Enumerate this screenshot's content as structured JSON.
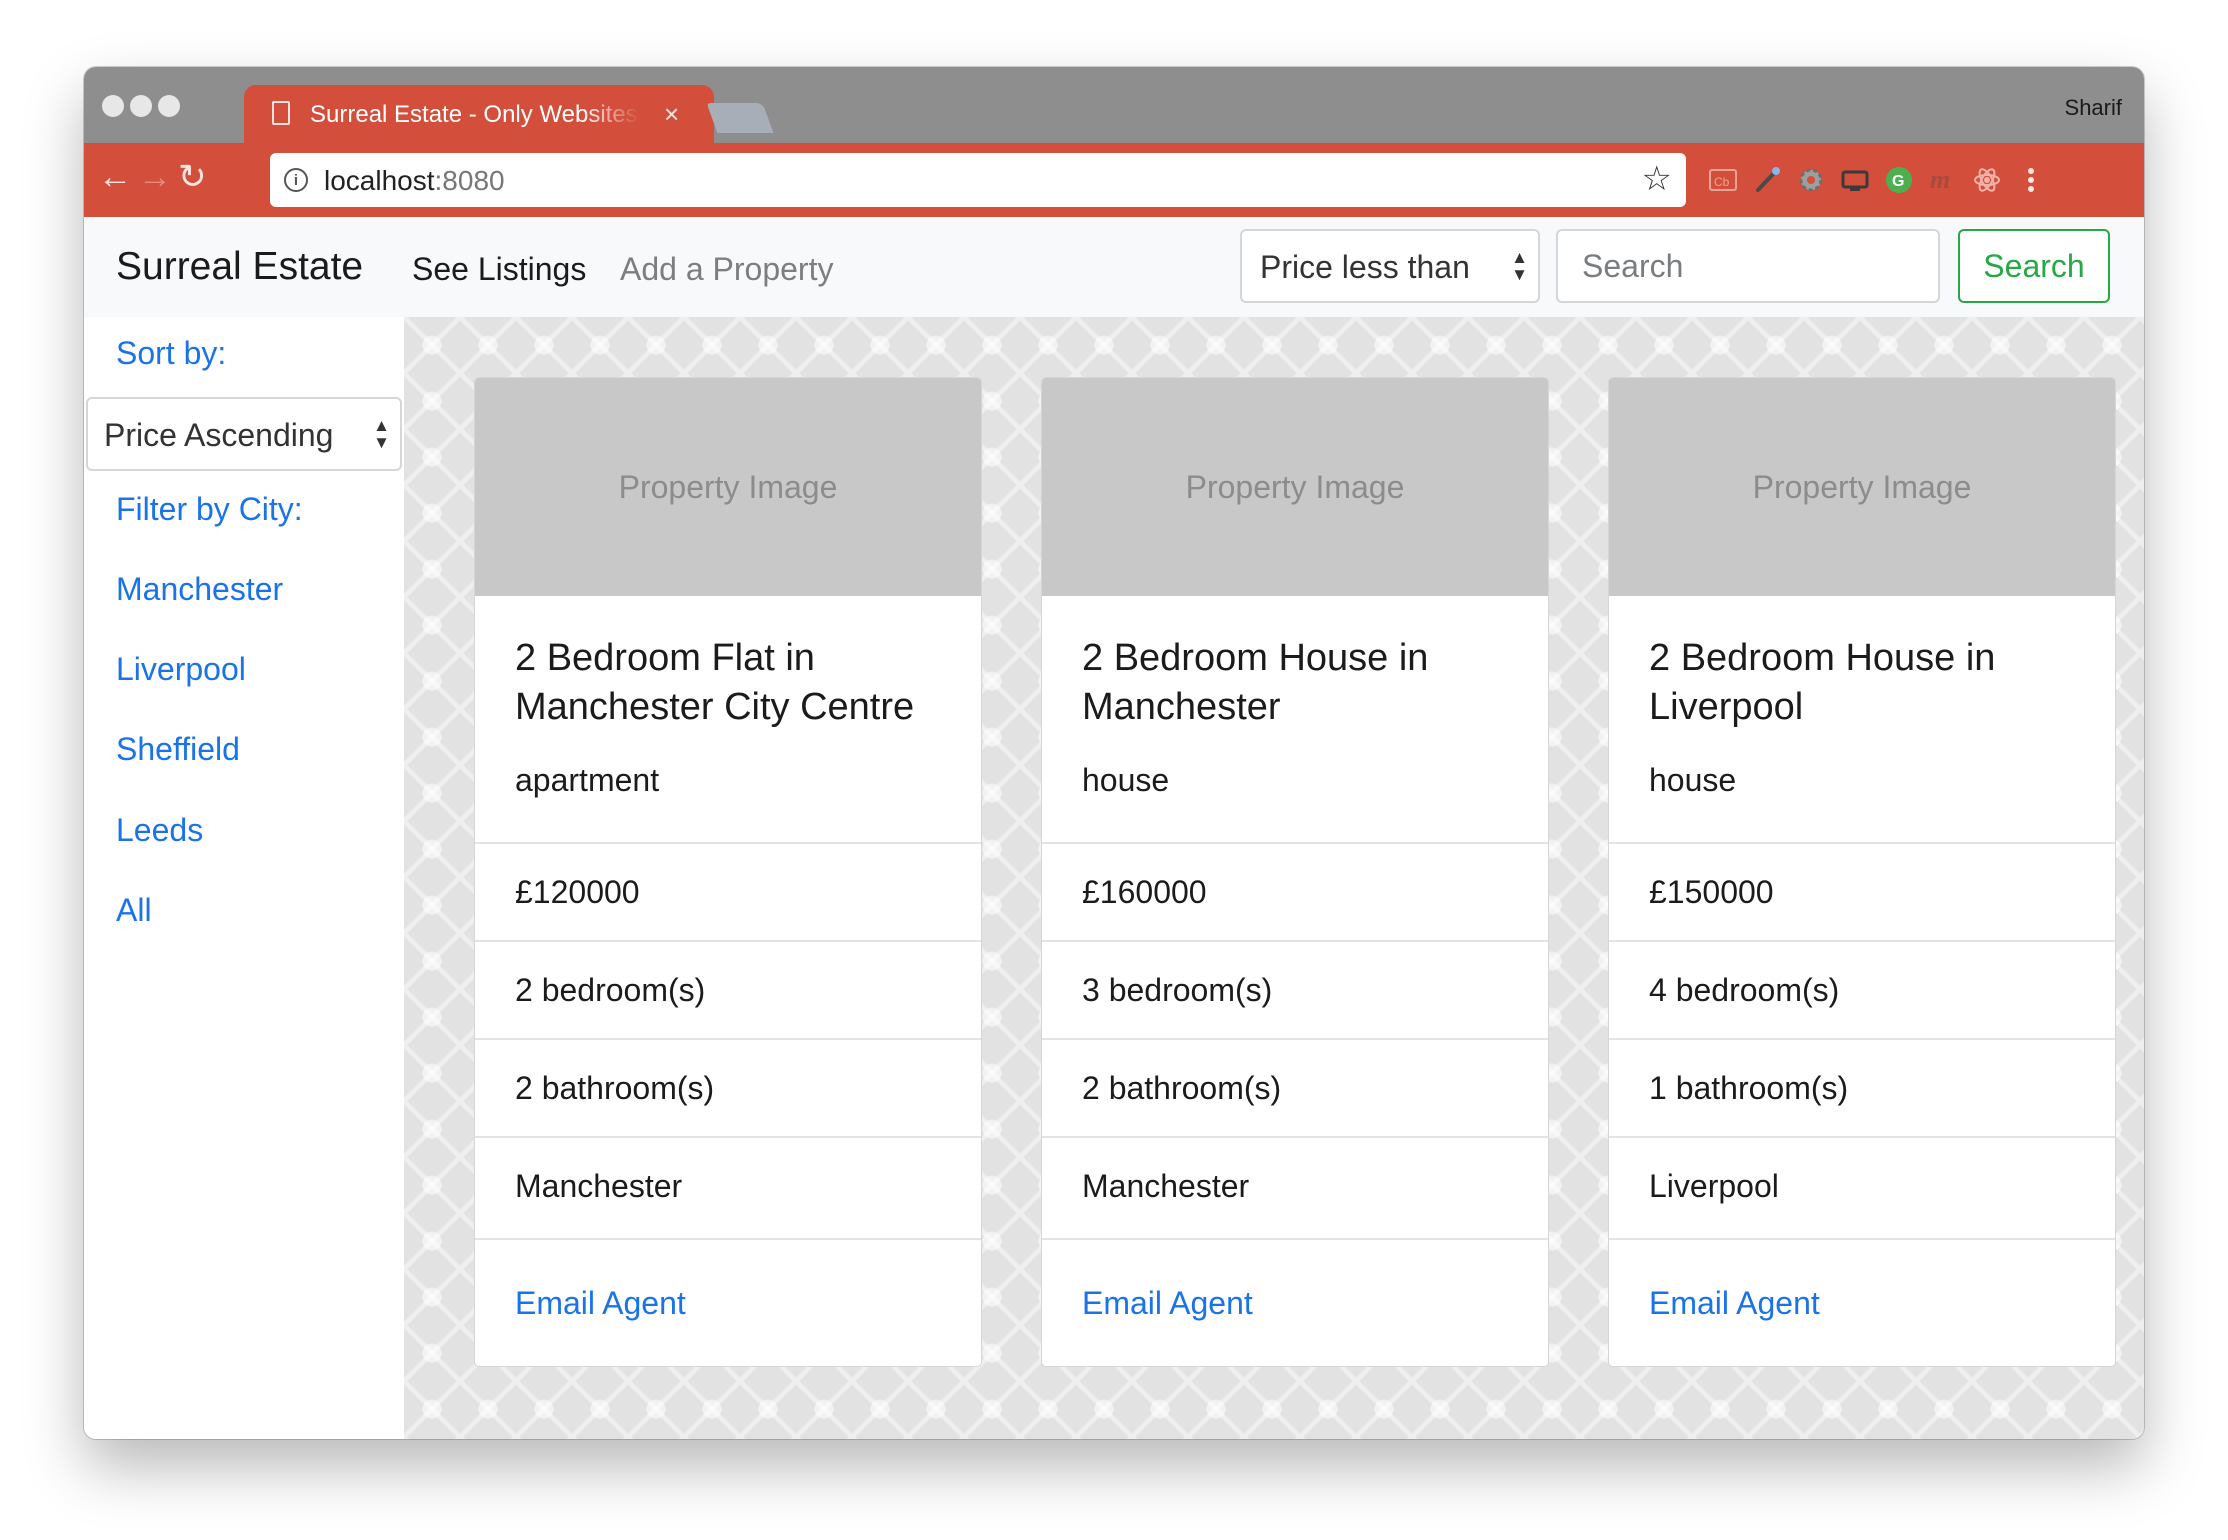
{
  "browser": {
    "tab_title": "Surreal Estate - Only Websites",
    "tab_close": "×",
    "profile_name": "Sharif",
    "url_host": "localhost",
    "url_port": ":8080",
    "info_icon": "i",
    "accent_color": "#d34f3c"
  },
  "navbar": {
    "brand": "Surreal Estate",
    "links": [
      "See Listings",
      "Add a Property"
    ],
    "filter_select": "Price less than",
    "search_placeholder": "Search",
    "search_button": "Search"
  },
  "sidebar": {
    "sort_label": "Sort by:",
    "sort_value": "Price Ascending",
    "filter_label": "Filter by City:",
    "cities": [
      "Manchester",
      "Liverpool",
      "Sheffield",
      "Leeds",
      "All"
    ]
  },
  "listings": [
    {
      "image_label": "Property Image",
      "title": "2 Bedroom Flat in Manchester City Centre",
      "type": "apartment",
      "price": "£120000",
      "bedrooms": "2 bedroom(s)",
      "bathrooms": "2 bathroom(s)",
      "city": "Manchester",
      "action": "Email Agent"
    },
    {
      "image_label": "Property Image",
      "title": "2 Bedroom House in Manchester",
      "type": "house",
      "price": "£160000",
      "bedrooms": "3 bedroom(s)",
      "bathrooms": "2 bathroom(s)",
      "city": "Manchester",
      "action": "Email Agent"
    },
    {
      "image_label": "Property Image",
      "title": "2 Bedroom House in Liverpool",
      "type": "house",
      "price": "£150000",
      "bedrooms": "4 bedroom(s)",
      "bathrooms": "1 bathroom(s)",
      "city": "Liverpool",
      "action": "Email Agent"
    }
  ]
}
